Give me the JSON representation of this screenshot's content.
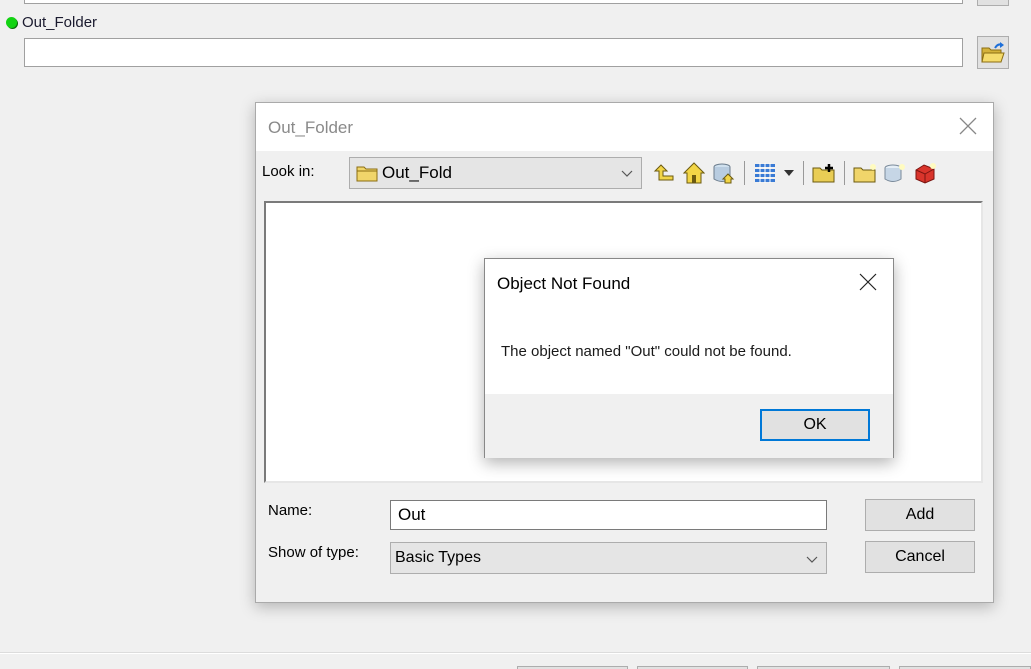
{
  "background_form": {
    "parameter_label": "Out_Folder",
    "parameter_status_color": "#12d312",
    "parameter_value": "",
    "browse_icon": "folder-open-arrow-icon"
  },
  "file_dialog": {
    "title": "Out_Folder",
    "look_in_label": "Look in:",
    "look_in_value": "Out_Fold",
    "toolbar_icons": [
      "up-one-level-icon",
      "home-folder-icon",
      "connect-to-database-icon",
      "view-list-icon",
      "view-dropdown-icon",
      "connect-to-folder-icon",
      "new-folder-icon",
      "new-geodatabase-icon",
      "new-toolbox-icon"
    ],
    "name_label": "Name:",
    "name_value": "Out",
    "type_label": "Show of type:",
    "type_value": "Basic Types",
    "add_label": "Add",
    "cancel_label": "Cancel"
  },
  "message_box": {
    "title": "Object Not Found",
    "message": "The object named \"Out\" could not be found.",
    "ok_label": "OK",
    "focus_color": "#0078d7"
  }
}
